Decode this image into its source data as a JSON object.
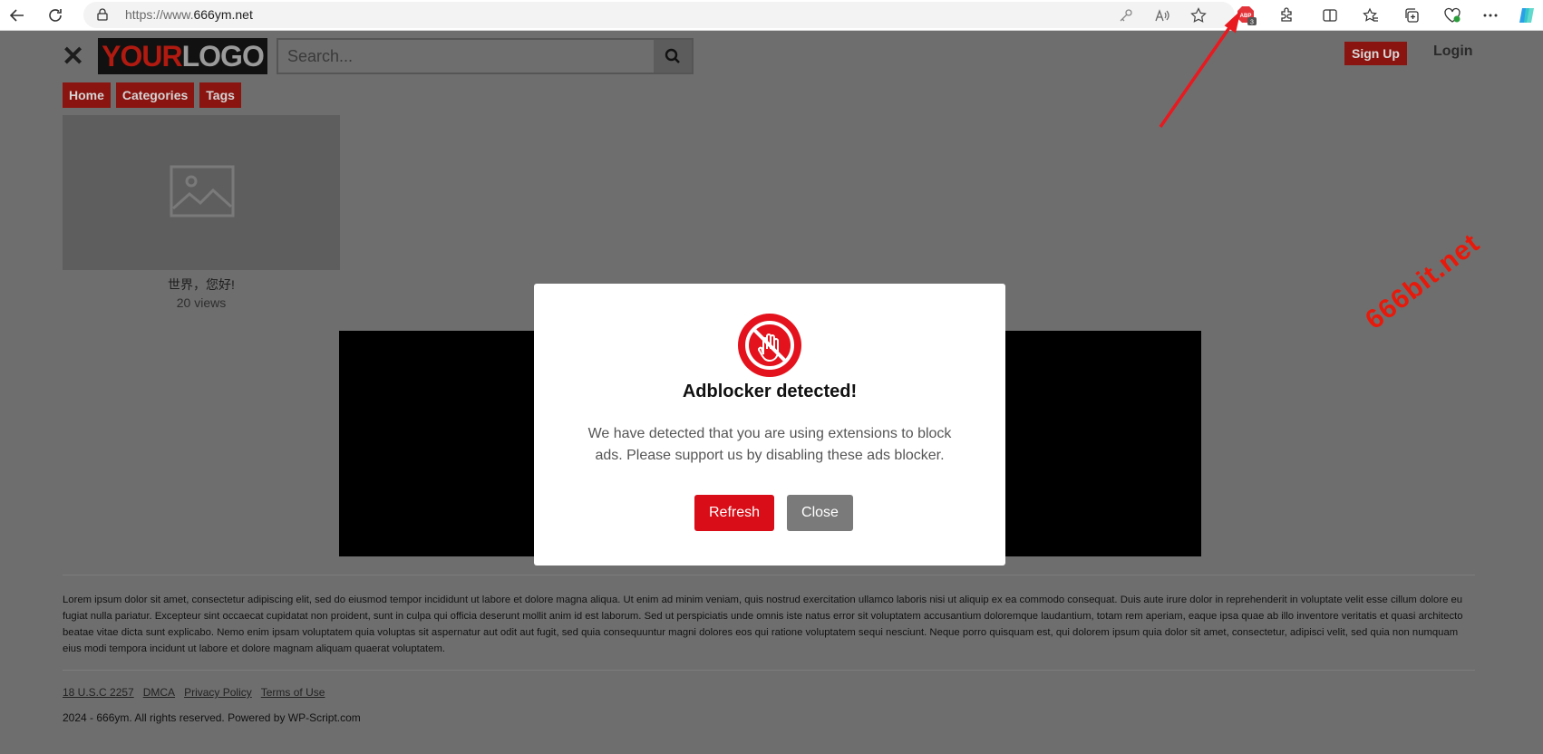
{
  "browser": {
    "url_prefix": "https://www.",
    "url_domain": "666ym.net",
    "abp_badge": "3"
  },
  "header": {
    "logo_part1": "YOUR",
    "logo_part2": "LOGO",
    "search_placeholder": "Search...",
    "signup_label": "Sign Up",
    "login_label": "Login"
  },
  "menu": {
    "items": [
      {
        "label": "Home"
      },
      {
        "label": "Categories"
      },
      {
        "label": "Tags"
      }
    ]
  },
  "video": {
    "title": "世界，您好!",
    "views": "20 views"
  },
  "footer": {
    "lorem": "Lorem ipsum dolor sit amet, consectetur adipiscing elit, sed do eiusmod tempor incididunt ut labore et dolore magna aliqua. Ut enim ad minim veniam, quis nostrud exercitation ullamco laboris nisi ut aliquip ex ea commodo consequat. Duis aute irure dolor in reprehenderit in voluptate velit esse cillum dolore eu fugiat nulla pariatur. Excepteur sint occaecat cupidatat non proident, sunt in culpa qui officia deserunt mollit anim id est laborum. Sed ut perspiciatis unde omnis iste natus error sit voluptatem accusantium doloremque laudantium, totam rem aperiam, eaque ipsa quae ab illo inventore veritatis et quasi architecto beatae vitae dicta sunt explicabo. Nemo enim ipsam voluptatem quia voluptas sit aspernatur aut odit aut fugit, sed quia consequuntur magni dolores eos qui ratione voluptatem sequi nesciunt. Neque porro quisquam est, qui dolorem ipsum quia dolor sit amet, consectetur, adipisci velit, sed quia non numquam eius modi tempora incidunt ut labore et dolore magnam aliquam quaerat voluptatem.",
    "links": [
      {
        "label": "18 U.S.C 2257"
      },
      {
        "label": "DMCA"
      },
      {
        "label": "Privacy Policy"
      },
      {
        "label": "Terms of Use"
      }
    ],
    "copyright": "2024 - 666ym. All rights reserved. Powered by WP-Script.com"
  },
  "watermark": "666bit.net",
  "modal": {
    "title": "Adblocker detected!",
    "message": "We have detected that you are using extensions to block ads. Please support us by disabling these ads blocker.",
    "refresh_label": "Refresh",
    "close_label": "Close"
  },
  "colors": {
    "brand_red": "#d90d17",
    "overlay_gray": "#6e6e6e"
  }
}
